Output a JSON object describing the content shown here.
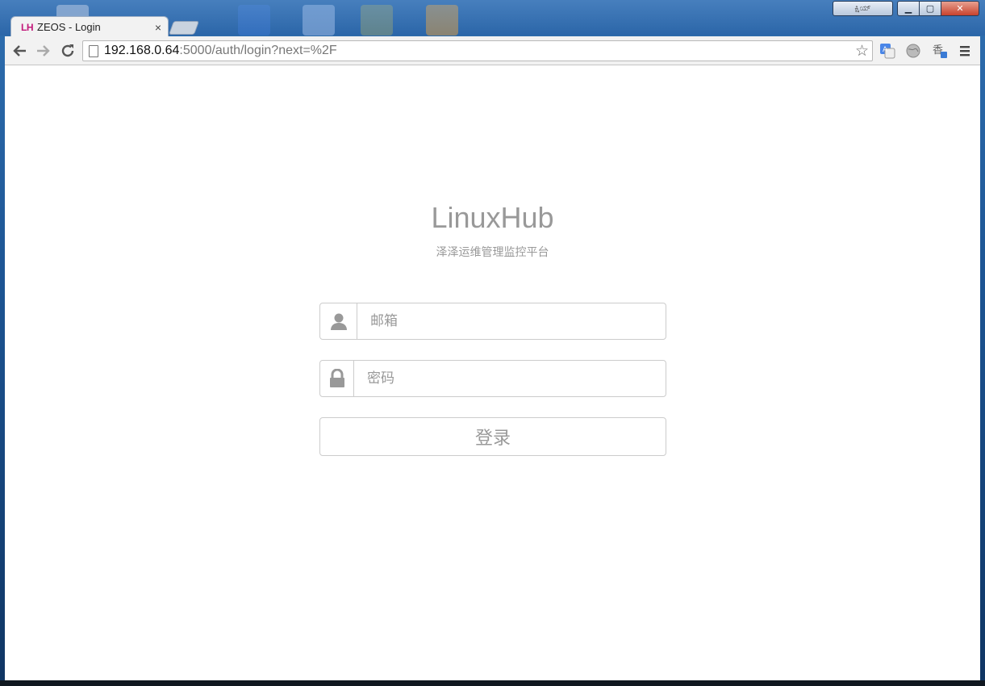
{
  "browser": {
    "tab_favicon": "LH",
    "tab_title": "ZEOS - Login",
    "tab_close": "×",
    "url_host": "192.168.0.64",
    "url_path": ":5000/auth/login?next=%2F",
    "ext_label": "ಕ್ಷಿಯ್"
  },
  "page": {
    "title": "LinuxHub",
    "subtitle": "泽泽运维管理监控平台",
    "email_placeholder": "邮箱",
    "password_placeholder": "密码",
    "login_label": "登录"
  },
  "colors": {
    "muted_text": "#999999",
    "border": "#cccccc",
    "favicon": "#c2187a"
  },
  "icons": [
    "back-arrow-icon",
    "forward-arrow-icon",
    "reload-icon",
    "page-icon",
    "star-icon",
    "translate-icon",
    "globe-icon",
    "extension-icon",
    "menu-icon",
    "user-icon",
    "lock-icon"
  ]
}
